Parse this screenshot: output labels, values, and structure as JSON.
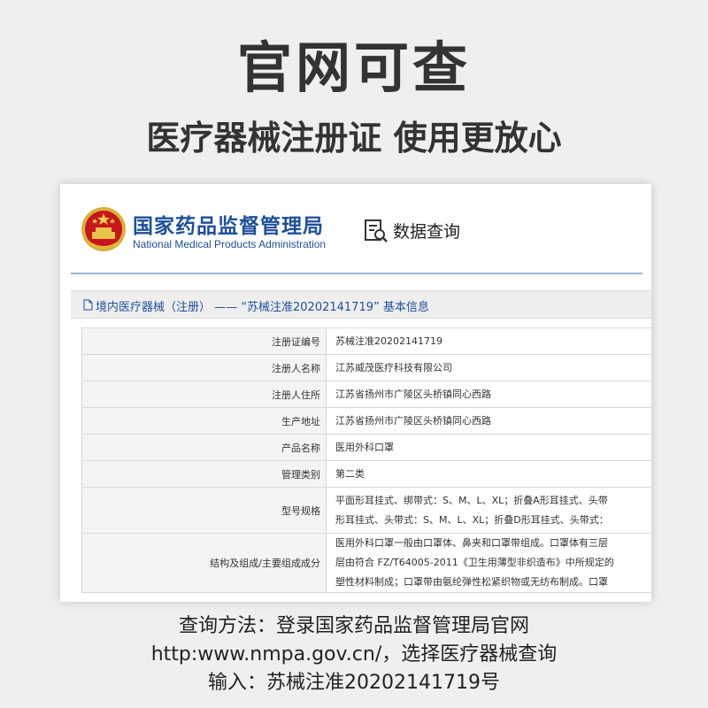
{
  "headline": "官网可查",
  "subheadline": "医疗器械注册证  使用更放心",
  "site": {
    "org_name_cn": "国家药品监督管理局",
    "org_name_en": "National Medical Products Administration",
    "emblem_icon": "national-emblem-icon",
    "query_icon": "document-search-icon",
    "query_label": "数据查询",
    "accent_color": "#1d4f9c"
  },
  "breadcrumb": {
    "icon": "document-icon",
    "text": "境内医疗器械（注册） —— “苏械注准20202141719” 基本信息"
  },
  "record": {
    "rows": [
      {
        "label": "注册证编号",
        "lines": [
          "苏械注准20202141719"
        ]
      },
      {
        "label": "注册人名称",
        "lines": [
          "江苏威茂医疗科技有限公司"
        ]
      },
      {
        "label": "注册人住所",
        "lines": [
          "江苏省扬州市广陵区头桥镇同心西路"
        ]
      },
      {
        "label": "生产地址",
        "lines": [
          "江苏省扬州市广陵区头桥镇同心西路"
        ]
      },
      {
        "label": "产品名称",
        "lines": [
          "医用外科口罩"
        ]
      },
      {
        "label": "管理类别",
        "lines": [
          "第二类"
        ]
      },
      {
        "label": "型号规格",
        "lines": [
          "平面形耳挂式、绑带式：S、M、L、XL；折叠A形耳挂式、头带",
          "形耳挂式、头带式：S、M、L、XL；折叠D形耳挂式、头带式："
        ]
      },
      {
        "label": "结构及组成/主要组成成分",
        "lines": [
          "医用外科口罩一般由口罩体、鼻夹和口罩带组成。口罩体有三层",
          "层由符合 FZ/T64005-2011《卫生用薄型非织造布》中所规定的",
          "塑性材料制成；口罩带由氨纶弹性松紧织物或无纺布制成。口罩"
        ]
      }
    ]
  },
  "footer": {
    "line1": "查询方法：登录国家药品监督管理局官网",
    "line2": "http:www.nmpa.gov.cn/，选择医疗器械查询",
    "line3": "输入：苏械注准20202141719号"
  }
}
